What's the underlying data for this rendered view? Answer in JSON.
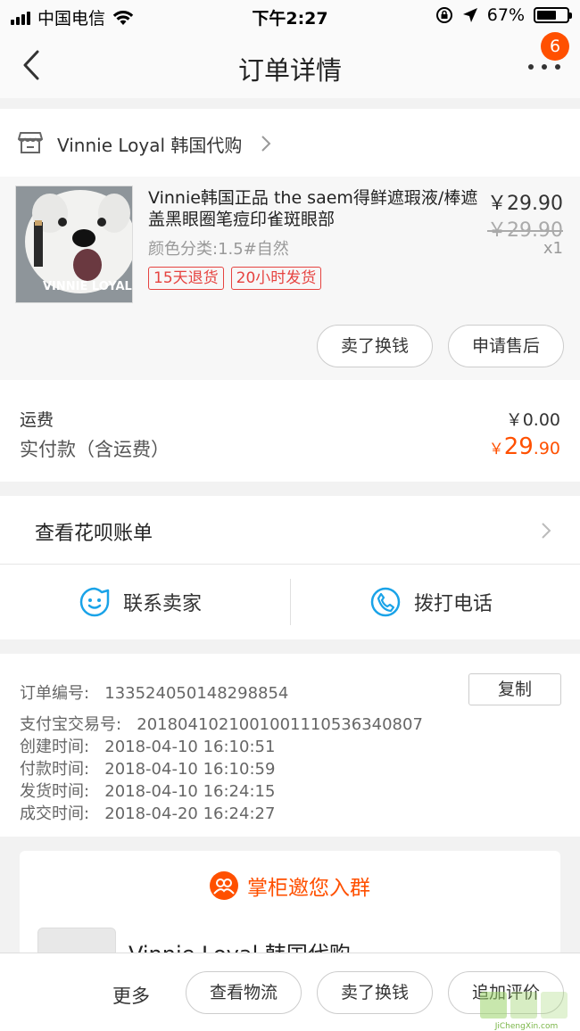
{
  "status_bar": {
    "carrier": "中国电信",
    "time": "下午2:27",
    "battery": "67%",
    "battery_level": 0.67
  },
  "header": {
    "title": "订单详情",
    "badge_count": "6"
  },
  "shop": {
    "name": "Vinnie Loyal 韩国代购"
  },
  "product": {
    "title": "Vinnie韩国正品 the saem得鲜遮瑕液/棒遮盖黑眼圈笔痘印雀斑眼部",
    "sku": "颜色分类:1.5#自然",
    "tags": [
      "15天退货",
      "20小时发货"
    ],
    "price": "￥29.90",
    "original_price": "￥29.90",
    "quantity": "x1",
    "thumb_text": "VINNIE LOYAL"
  },
  "actions": {
    "sell_label": "卖了换钱",
    "after_sale_label": "申请售后"
  },
  "fees": {
    "shipping_label": "运费",
    "shipping_value": "￥0.00",
    "paid_label": "实付款（含运费）",
    "paid_currency": "￥",
    "paid_int": "29",
    "paid_dec": ".90"
  },
  "huabei": {
    "label": "查看花呗账单"
  },
  "contact": {
    "seller_label": "联系卖家",
    "phone_label": "拨打电话"
  },
  "order_info": {
    "order_no_label": "订单编号:",
    "order_no": "133524050148298854",
    "copy_label": "复制",
    "rows": [
      {
        "label": "支付宝交易号:",
        "value": "2018041021001001110536340807"
      },
      {
        "label": "创建时间:",
        "value": "2018-04-10 16:10:51"
      },
      {
        "label": "付款时间:",
        "value": "2018-04-10 16:10:59"
      },
      {
        "label": "发货时间:",
        "value": "2018-04-10 16:24:15"
      },
      {
        "label": "成交时间:",
        "value": "2018-04-20 16:24:27"
      }
    ]
  },
  "group": {
    "title": "掌柜邀您入群",
    "name": "Vinnie Loyal 韩国代购"
  },
  "bottom_bar": {
    "more_label": "更多",
    "logistics_label": "查看物流",
    "sell_label": "卖了换钱",
    "review_label": "追加评价"
  },
  "watermark": {
    "text": "JiChengXin.com"
  },
  "colors": {
    "accent": "#ff5000",
    "tag_red": "#e64340",
    "contact_blue": "#1aa3e8"
  }
}
